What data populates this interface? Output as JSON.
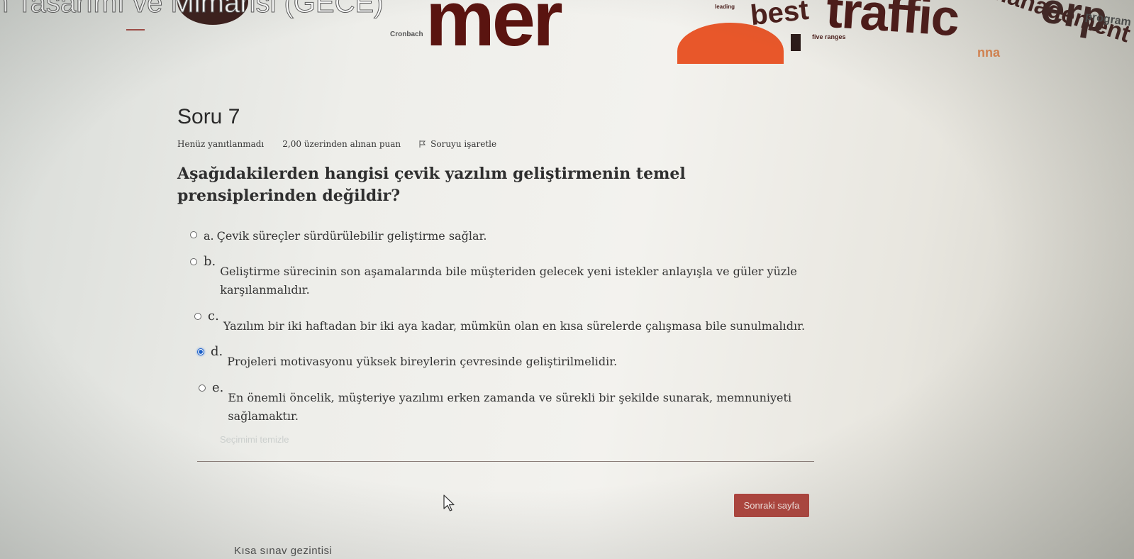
{
  "course": {
    "title": "n Tasarımı ve Mimarisi (GECE)"
  },
  "question": {
    "title": "Soru 7",
    "status": "Henüz yanıtlanmadı",
    "points": "2,00 üzerinden alınan puan",
    "flag_label": "Soruyu işaretle",
    "text": "Aşağıdakilerden hangisi çevik yazılım geliştirmenin temel prensiplerinden değildir?"
  },
  "answers": [
    {
      "letter": "a.",
      "text": "Çevik süreçler sürdürülebilir geliştirme sağlar.",
      "selected": false
    },
    {
      "letter": "b.",
      "text": "Geliştirme sürecinin son aşamalarında bile müşteriden gelecek yeni istekler anlayışla ve güler yüzle karşılanmalıdır.",
      "selected": false
    },
    {
      "letter": "c.",
      "text": "Yazılım bir iki haftadan bir iki aya kadar, mümkün olan en kısa sürelerde çalışmasa bile sunulmalıdır.",
      "selected": false
    },
    {
      "letter": "d.",
      "text": "Projeleri motivasyonu yüksek bireylerin çevresinde geliştirilmelidir.",
      "selected": true
    },
    {
      "letter": "e.",
      "text": "En önemli öncelik, müşteriye yazılımı erken zamanda ve sürekli bir şekilde sunarak, memnuniyeti sağlamaktır.",
      "selected": false
    }
  ],
  "clear_choice_label": "Seçimimi temizle",
  "next_button": "Sonraki sayfa",
  "nav_title": "Kısa sınav gezintisi",
  "colors": {
    "accent": "#b0433c",
    "selected_radio": "#1b5fc7"
  }
}
